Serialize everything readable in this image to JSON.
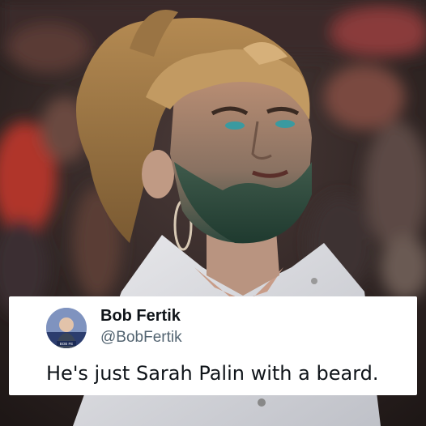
{
  "tweet": {
    "display_name": "Bob Fertik",
    "handle": "@BobFertik",
    "text": "He's just Sarah Palin with a beard.",
    "avatar_caption": "BOB FE"
  }
}
